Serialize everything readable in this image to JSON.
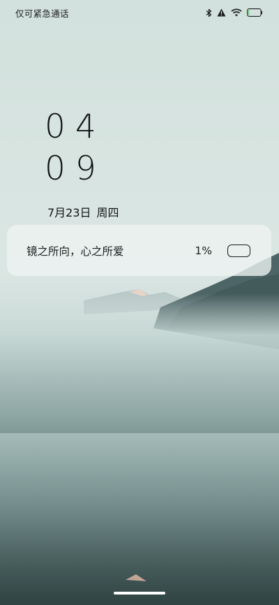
{
  "status_bar": {
    "carrier": "仅可紧急通话",
    "icons": [
      "bluetooth-icon",
      "warning-icon",
      "wifi-icon",
      "battery-icon"
    ],
    "battery_level": 0.01
  },
  "clock": {
    "hours": "04",
    "minutes": "09"
  },
  "date": {
    "day": "7月23日",
    "weekday": "周四"
  },
  "battery_card": {
    "message": "镜之所向，心之所爱",
    "percent": "1%",
    "icon": "battery-outline-icon"
  },
  "colors": {
    "text": "#121416",
    "card": "#ecf3f1",
    "home_indicator": "#ffffff"
  }
}
